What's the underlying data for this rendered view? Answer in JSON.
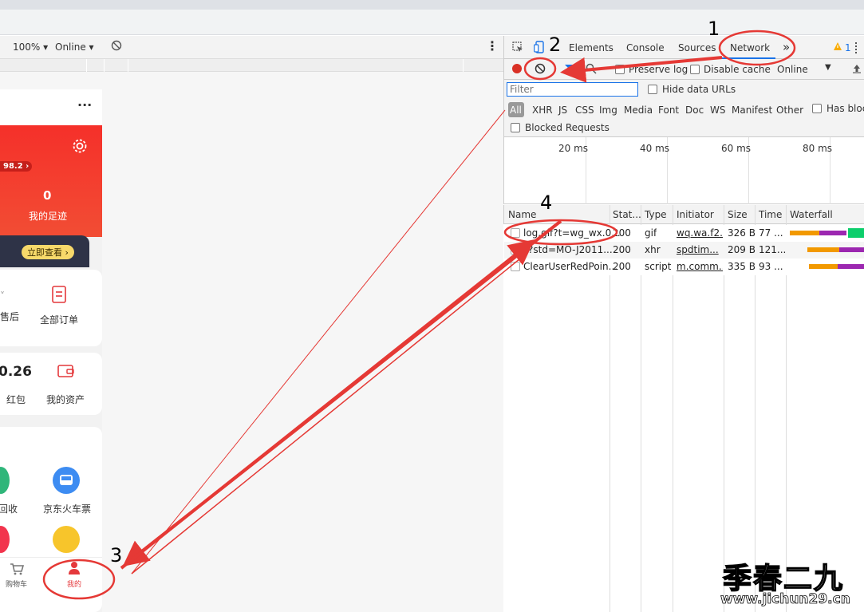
{
  "device_toolbar": {
    "zoom": "100% ▾",
    "throttle": "Online ▾"
  },
  "phone": {
    "header_more": "···",
    "score": "98.2 ›",
    "footprint_count": "0",
    "footprint_label": "我的足迹",
    "check_now": "立即查看 ›",
    "aftersale": "售后",
    "all_orders": "全部订单",
    "amount": "0.26",
    "red_packet": "红包",
    "my_assets": "我的资产",
    "recycle": "回收",
    "train_ticket": "京东火车票",
    "nav_cart": "购物车",
    "nav_mine": "我的"
  },
  "devtools": {
    "tabs": [
      "Elements",
      "Console",
      "Sources",
      "Network"
    ],
    "more": "»",
    "warn_count": "1",
    "preserve_log": "Preserve log",
    "disable_cache": "Disable cache",
    "throttle": "Online",
    "filter_placeholder": "Filter",
    "hide_data_urls": "Hide data URLs",
    "types": [
      "All",
      "XHR",
      "JS",
      "CSS",
      "Img",
      "Media",
      "Font",
      "Doc",
      "WS",
      "Manifest",
      "Other"
    ],
    "has_blocked": "Has bloc",
    "blocked_requests": "Blocked Requests",
    "timeline_ticks": [
      "20 ms",
      "40 ms",
      "60 ms",
      "80 ms"
    ],
    "columns": [
      "Name",
      "Stat...",
      "Type",
      "Initiator",
      "Size",
      "Time",
      "Waterfall"
    ],
    "rows": [
      {
        "name": "log.gif?t=wg_wx.0...",
        "status": "200",
        "type": "gif",
        "initiator": "wq.wa.f2...",
        "size": "326 B",
        "time": "77 ..."
      },
      {
        "name": "?std=MO-J2011...",
        "status": "200",
        "type": "xhr",
        "initiator": "spdtim...",
        "size": "209 B",
        "time": "121..."
      },
      {
        "name": "ClearUserRedPoin...",
        "status": "200",
        "type": "script",
        "initiator": "m.comm...",
        "size": "335 B",
        "time": "93 ..."
      }
    ]
  },
  "annotations": [
    "1",
    "2",
    "3",
    "4"
  ],
  "watermark": {
    "title": "季春二九",
    "url": "www.jichun29.cn"
  },
  "colors": {
    "accent_red": "#e53935",
    "jd_red": "#f5302a",
    "devtools_blue": "#1a73e8"
  }
}
